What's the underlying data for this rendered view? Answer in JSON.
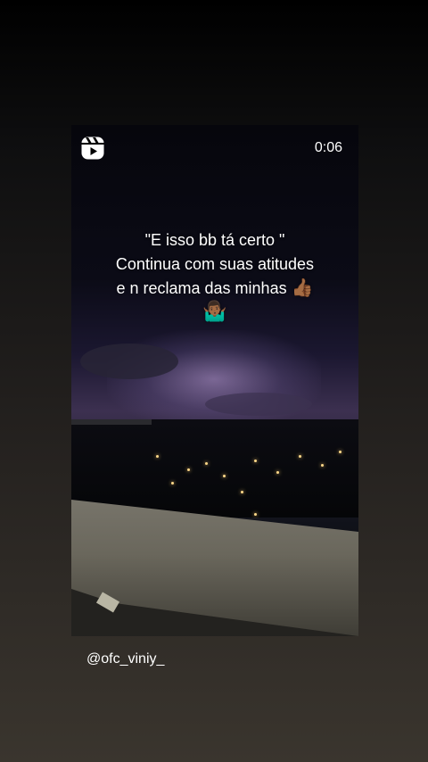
{
  "story": {
    "timer": "0:06",
    "caption": {
      "line1": "\"E isso bb tá certo \"",
      "line2": "Continua com suas atitudes",
      "line3": "e n reclama das minhas",
      "emoji_thumbs": "👍🏾",
      "emoji_shrug": "🤷🏾‍♂️"
    },
    "username": "@ofc_viniy_"
  },
  "icons": {
    "reels": "reels-icon"
  },
  "colors": {
    "text": "#ffffff"
  }
}
